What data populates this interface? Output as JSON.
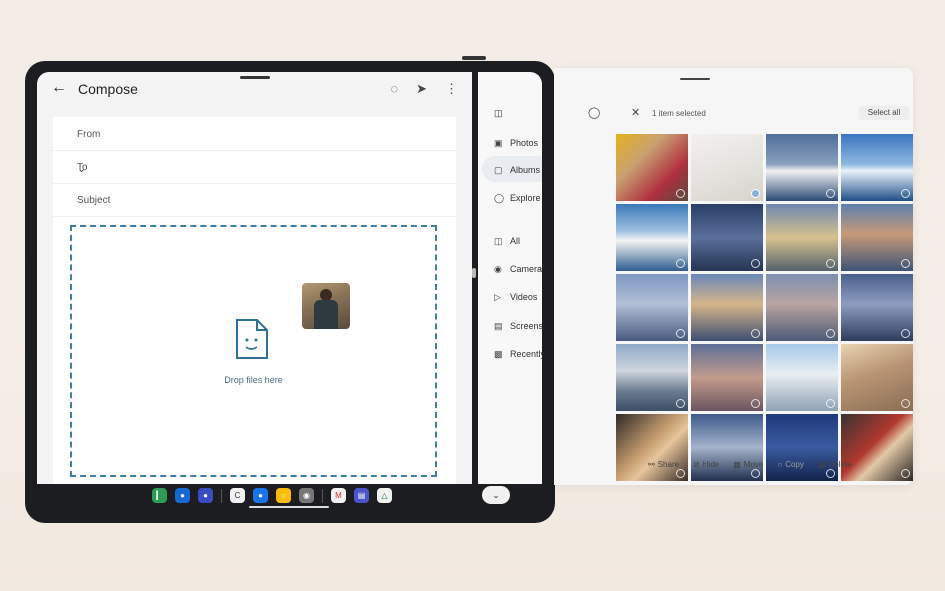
{
  "compose": {
    "title": "Compose",
    "from_label": "From",
    "to_label": "To",
    "subject_label": "Subject",
    "drop_text": "Drop files here"
  },
  "rail": {
    "items": [
      {
        "label": "Photos",
        "icon": "image-icon"
      },
      {
        "label": "Albums",
        "icon": "album-icon"
      },
      {
        "label": "Explore",
        "icon": "explore-icon"
      },
      {
        "label": "All",
        "icon": "folder-icon"
      },
      {
        "label": "Camera",
        "icon": "camera-icon"
      },
      {
        "label": "Videos",
        "icon": "video-icon"
      },
      {
        "label": "Screenshots",
        "icon": "screenshot-icon"
      },
      {
        "label": "Recently deleted",
        "icon": "trash-icon"
      }
    ]
  },
  "picker": {
    "selected_count": "1 item selected",
    "select_all": "Select all",
    "actions": [
      {
        "label": "Share",
        "icon": "share-icon"
      },
      {
        "label": "Hide",
        "icon": "hide-icon"
      },
      {
        "label": "Move",
        "icon": "move-icon"
      },
      {
        "label": "Copy",
        "icon": "copy-icon"
      },
      {
        "label": "Delete",
        "icon": "delete-icon"
      }
    ]
  },
  "colors": {
    "accent": "#3d7fa6",
    "dropzone_text": "#4c6e86",
    "device_frame": "#1b1d20"
  },
  "taskbar": {
    "apps": [
      "phone-app",
      "messages-app",
      "duo-app",
      "contacts-app",
      "maps-app",
      "chrome-app",
      "camera-app",
      "gmail-app",
      "docs-app",
      "drive-app"
    ]
  }
}
